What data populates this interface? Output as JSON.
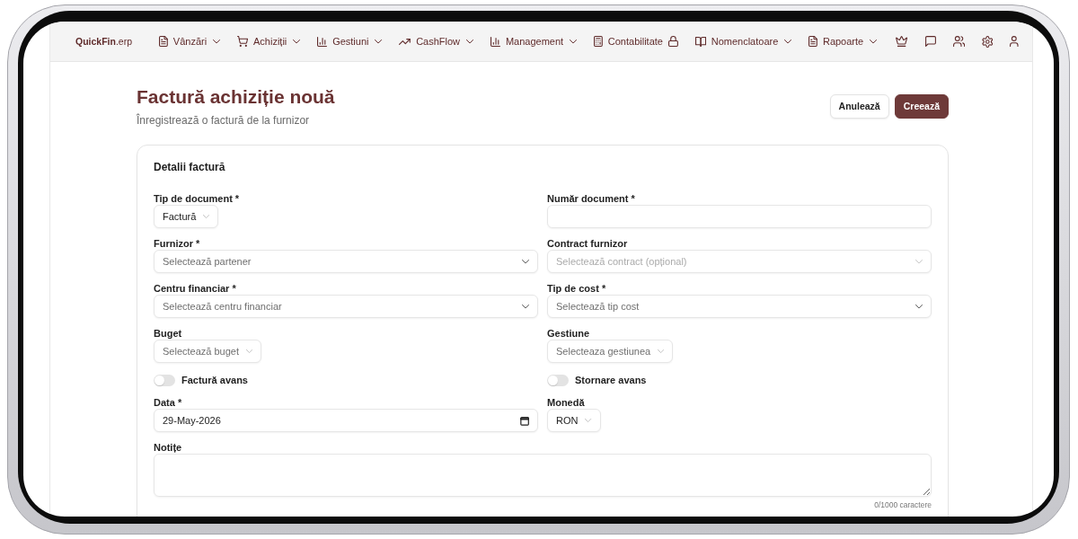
{
  "app": {
    "logo": "**QuickFin**.erp"
  },
  "nav": [
    {
      "label": "Vânzări",
      "dropdown": true,
      "locked": false
    },
    {
      "label": "Achiziții",
      "dropdown": true,
      "locked": false
    },
    {
      "label": "Gestiuni",
      "dropdown": true,
      "locked": false
    },
    {
      "label": "CashFlow",
      "dropdown": true,
      "locked": false
    },
    {
      "label": "Management",
      "dropdown": true,
      "locked": false
    },
    {
      "label": "Contabilitate",
      "dropdown": false,
      "locked": true
    },
    {
      "label": "Nomenclatoare",
      "dropdown": true,
      "locked": false
    },
    {
      "label": "Rapoarte",
      "dropdown": true,
      "locked": false
    }
  ],
  "page": {
    "title": "Factură achiziție nouă",
    "subtitle": "Înregistrează o factură de la furnizor",
    "actions": [
      {
        "label": "Anulează",
        "kind": "secondary"
      },
      {
        "label": "Creează",
        "kind": "primary"
      }
    ]
  },
  "card": {
    "title": "Detalii factură",
    "fields": [
      {
        "kind": "select",
        "label": "Tip de document *",
        "value": "Factură",
        "disabled": false
      },
      {
        "kind": "text",
        "label": "Număr document *",
        "disabled": false
      },
      {
        "kind": "combobox",
        "label": "Furnizor *",
        "placeholder": "Selectează partener",
        "disabled": false
      },
      {
        "kind": "combobox",
        "label": "Contract furnizor",
        "placeholder": "Selectează contract (opțional)",
        "disabled": true
      },
      {
        "kind": "combobox",
        "label": "Centru financiar *",
        "placeholder": "Selectează centru financiar",
        "disabled": false
      },
      {
        "kind": "combobox",
        "label": "Tip de cost *",
        "placeholder": "Selectează tip cost",
        "disabled": false
      },
      {
        "kind": "select",
        "label": "Buget",
        "placeholder": "Selectează buget",
        "disabled": false
      },
      {
        "kind": "select",
        "label": "Gestiune",
        "placeholder": "Selecteaza gestiunea",
        "disabled": false
      },
      {
        "kind": "toggle",
        "label": "Factură avans",
        "on": false
      },
      {
        "kind": "toggle",
        "label": "Stornare avans",
        "on": false
      },
      {
        "kind": "date",
        "label": "Data *",
        "value": "29-May-2026",
        "disabled": false
      },
      {
        "kind": "select",
        "label": "Monedă",
        "value": "RON",
        "disabled": false
      },
      {
        "kind": "textarea",
        "label": "Notițe",
        "counter": "0/1000 caractere",
        "disabled": false
      }
    ]
  }
}
